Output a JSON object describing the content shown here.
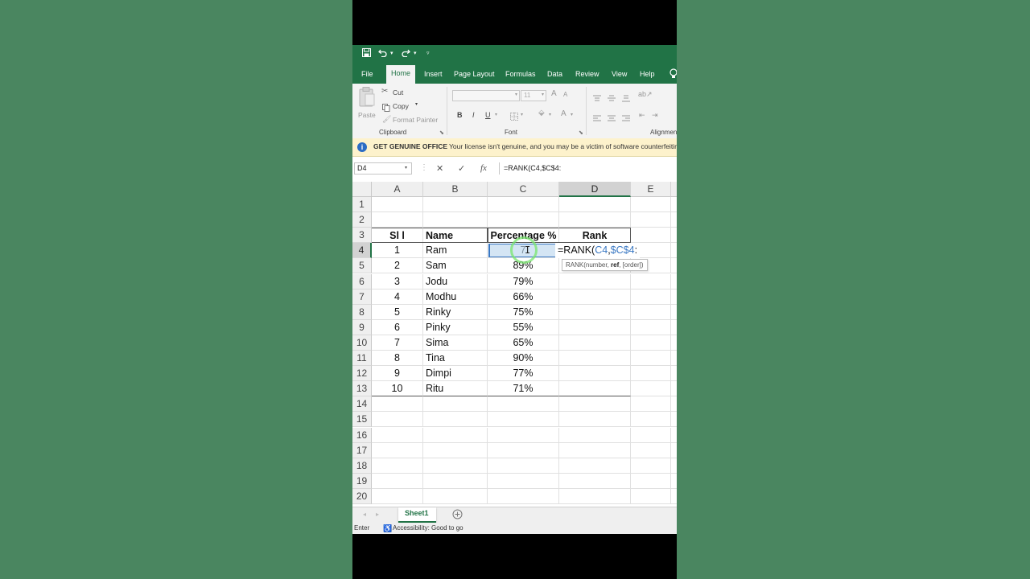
{
  "qat": {
    "undo_caret": "▾",
    "redo_caret": "▾",
    "customize_caret": "▿"
  },
  "tabs": [
    "File",
    "Home",
    "Insert",
    "Page Layout",
    "Formulas",
    "Data",
    "Review",
    "View",
    "Help"
  ],
  "active_tab": "Home",
  "ribbon": {
    "paste": "Paste",
    "cut": "Cut",
    "copy": "Copy",
    "format_painter": "Format Painter",
    "clipboard_label": "Clipboard",
    "font_size": "11",
    "font_label": "Font",
    "bold": "B",
    "italic": "I",
    "underline": "U",
    "grow_font": "A",
    "shrink_font": "A",
    "font_color": "A",
    "alignment_label": "Alignment"
  },
  "notice": {
    "title": "GET GENUINE OFFICE",
    "message": "Your license isn't genuine, and you may be a victim of software counterfeiting"
  },
  "formula_bar": {
    "name_box": "D4",
    "cancel": "✕",
    "enter": "✓",
    "fx": "fx",
    "formula": "=RANK(C4,$C$4:"
  },
  "columns": [
    "A",
    "B",
    "C",
    "D",
    "E"
  ],
  "selected_column": "D",
  "row_numbers": [
    "1",
    "2",
    "3",
    "4",
    "5",
    "6",
    "7",
    "8",
    "9",
    "10",
    "11",
    "12",
    "13",
    "14",
    "15",
    "16",
    "17",
    "18",
    "19",
    "20"
  ],
  "selected_row": "4",
  "table": {
    "headers": [
      "Sl l",
      "Name",
      "Percentage %",
      "Rank"
    ],
    "rows": [
      [
        "1",
        "Ram",
        "7",
        ""
      ],
      [
        "2",
        "Sam",
        "89%",
        ""
      ],
      [
        "3",
        "Jodu",
        "79%",
        ""
      ],
      [
        "4",
        "Modhu",
        "66%",
        ""
      ],
      [
        "5",
        "Rinky",
        "75%",
        ""
      ],
      [
        "6",
        "Pinky",
        "55%",
        ""
      ],
      [
        "7",
        "Sima",
        "65%",
        ""
      ],
      [
        "8",
        "Tina",
        "90%",
        ""
      ],
      [
        "9",
        "Dimpi",
        "77%",
        ""
      ],
      [
        "10",
        "Ritu",
        "71%",
        ""
      ]
    ]
  },
  "edit": {
    "prefix": "=RANK(",
    "ref1": "C4",
    "comma": ",",
    "ref2": "$C$4",
    "suffix": ":"
  },
  "tooltip": {
    "pre": "RANK(number, ",
    "bold": "ref",
    "post": ", [order])"
  },
  "sheets": [
    "Sheet1"
  ],
  "active_sheet": "Sheet1",
  "status": {
    "mode": "Enter",
    "accessibility": "Accessibility: Good to go"
  }
}
